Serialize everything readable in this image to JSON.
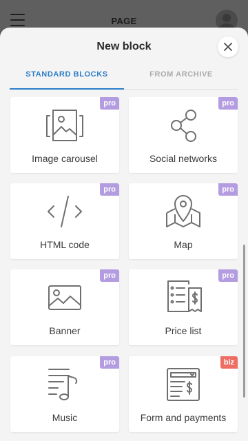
{
  "background_page": {
    "title": "PAGE"
  },
  "sheet": {
    "title": "New block",
    "tabs": [
      {
        "label": "STANDARD BLOCKS",
        "active": true
      },
      {
        "label": "FROM ARCHIVE",
        "active": false
      }
    ]
  },
  "blocks": [
    {
      "label": "Image carousel",
      "icon": "image-carousel-icon",
      "badge": "pro"
    },
    {
      "label": "Social networks",
      "icon": "share-icon",
      "badge": "pro"
    },
    {
      "label": "HTML code",
      "icon": "code-icon",
      "badge": "pro"
    },
    {
      "label": "Map",
      "icon": "map-pin-icon",
      "badge": "pro"
    },
    {
      "label": "Banner",
      "icon": "banner-image-icon",
      "badge": "pro"
    },
    {
      "label": "Price list",
      "icon": "price-list-icon",
      "badge": "pro"
    },
    {
      "label": "Music",
      "icon": "music-icon",
      "badge": "pro"
    },
    {
      "label": "Form and payments",
      "icon": "form-payment-icon",
      "badge": "biz"
    }
  ],
  "colors": {
    "accent": "#2b7ec9",
    "badge_pro": "#b39ce0",
    "badge_biz": "#ee6e64",
    "overlay": "#5f5f5f",
    "sheet_bg": "#f4f4f4",
    "icon_stroke": "#6f6f6f"
  }
}
